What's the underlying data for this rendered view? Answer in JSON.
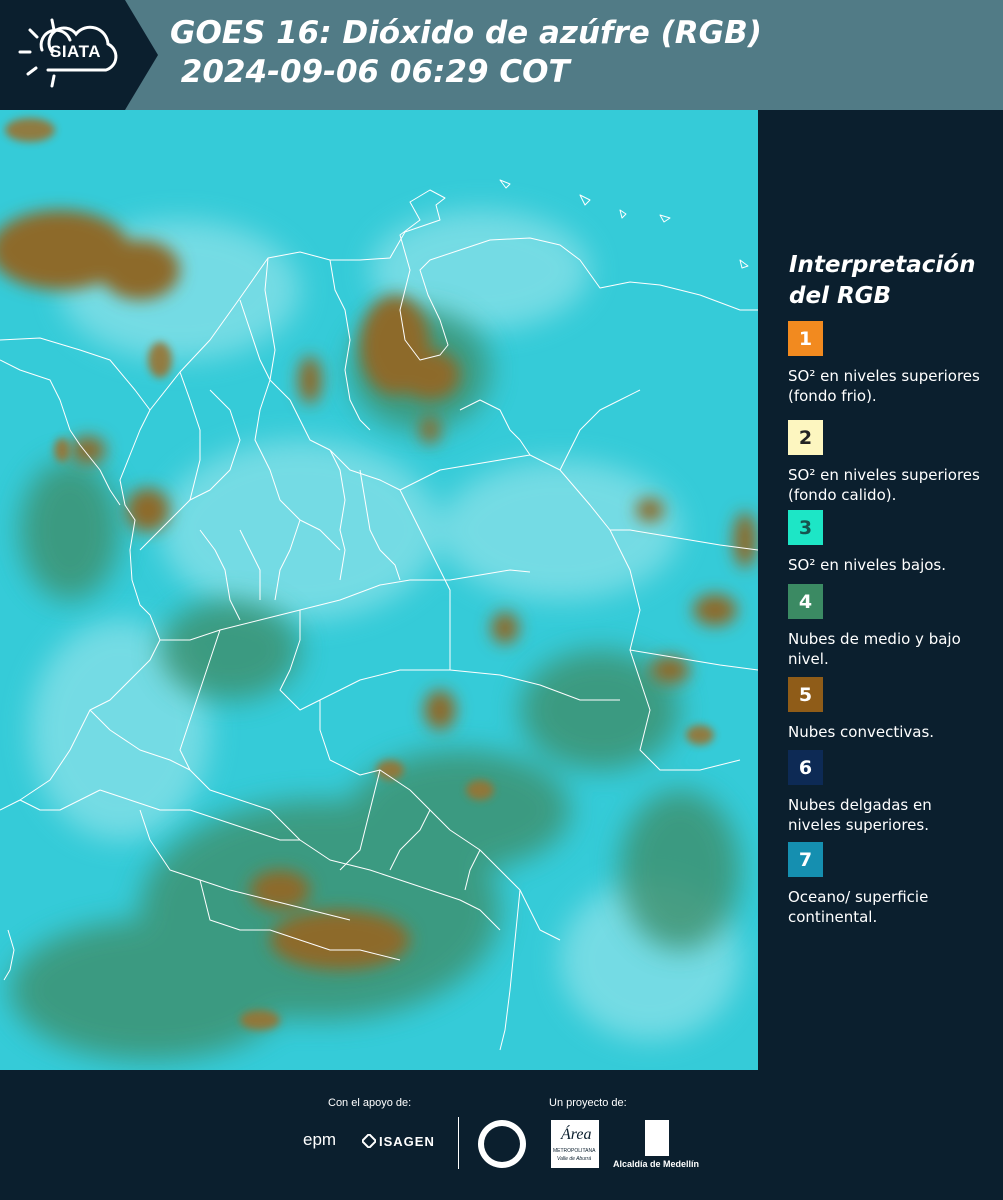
{
  "header": {
    "logo_text": "SIATA",
    "title_line1": "GOES 16: Dióxido de azúfre (RGB)",
    "title_line2": " 2024-09-06 06:29 COT"
  },
  "legend": {
    "title_line1": "Interpretación",
    "title_line2": "del RGB",
    "items": [
      {
        "number": "1",
        "color": "#f28a1f",
        "text": "SO² en niveles superiores (fondo frio)."
      },
      {
        "number": "2",
        "color": "#fdf6c0",
        "text": "SO² en niveles superiores (fondo calido)."
      },
      {
        "number": "3",
        "color": "#1de6c6",
        "text": "SO² en niveles bajos."
      },
      {
        "number": "4",
        "color": "#3b8a63",
        "text": "Nubes de medio y bajo nivel."
      },
      {
        "number": "5",
        "color": "#8f5c18",
        "text": "Nubes convectivas."
      },
      {
        "number": "6",
        "color": "#0d2a55",
        "text": "Nubes delgadas en niveles superiores."
      },
      {
        "number": "7",
        "color": "#158fb0",
        "text": "Oceano/ superficie continental."
      }
    ]
  },
  "footer": {
    "support_label": "Con el apoyo de:",
    "project_label": "Un proyecto de:",
    "sponsor1": "epm",
    "sponsor2": "ISAGEN",
    "area_top": "Área",
    "area_bottom": "METROPOLITANA",
    "area_sub": "Valle de Aburrá",
    "alcaldia": "Alcaldía de Medellín"
  },
  "colors": {
    "header_bg": "#517b86",
    "dark_bg": "#0b1f2e",
    "sky_cyan": "#2fc8d6",
    "cloud_brown": "#8f6a2a",
    "cloud_green": "#3f8c6a",
    "border_white": "#ffffff"
  }
}
